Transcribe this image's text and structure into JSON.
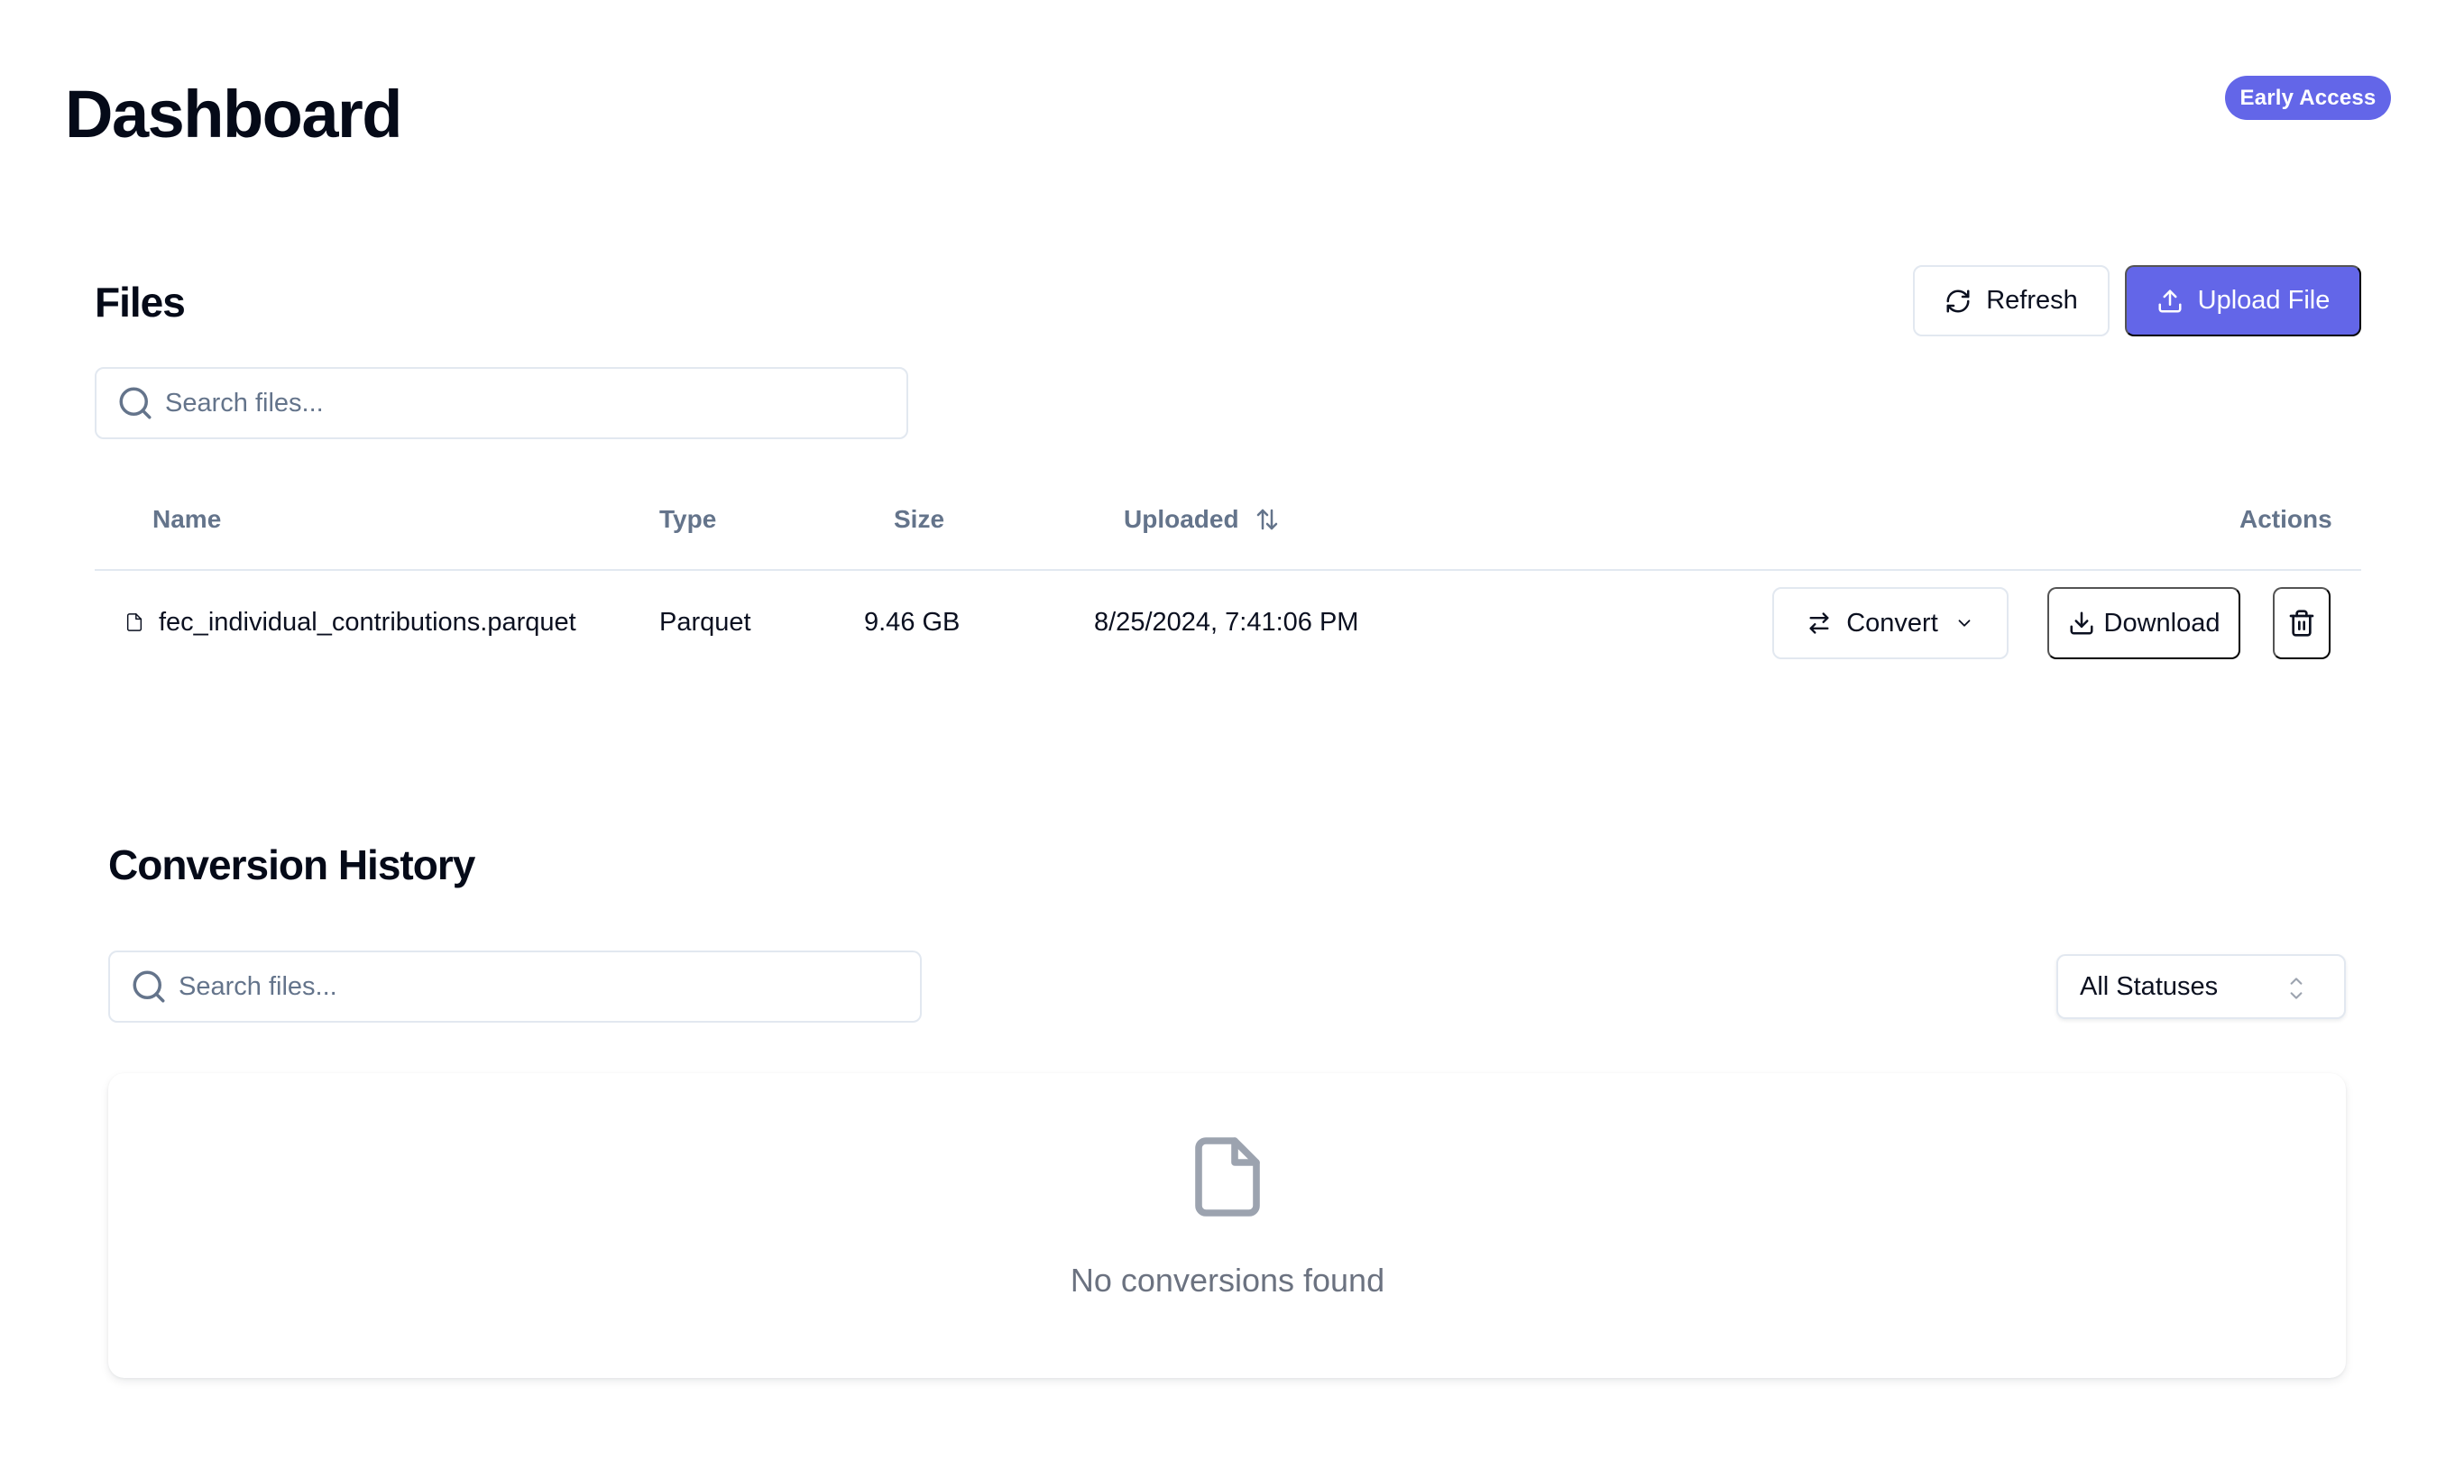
{
  "header": {
    "title": "Dashboard",
    "badge": "Early Access"
  },
  "colors": {
    "accent": "#6366e8",
    "text_primary": "#050a18",
    "text_muted": "#64748b",
    "border": "#e2e8f0",
    "empty_icon": "#9ca3af"
  },
  "files": {
    "title": "Files",
    "refresh_label": "Refresh",
    "refresh_icon": "refresh-icon",
    "upload_label": "Upload File",
    "upload_icon": "upload-icon",
    "search": {
      "placeholder": "Search files...",
      "value": ""
    },
    "table": {
      "columns": [
        {
          "label": "Name"
        },
        {
          "label": "Type"
        },
        {
          "label": "Size"
        },
        {
          "label": "Uploaded",
          "sort_icon": "sort-arrows-icon"
        },
        {
          "label": "Actions"
        }
      ],
      "rows": [
        {
          "name": "fec_individual_contributions.parquet",
          "type": "Parquet",
          "size": "9.46 GB",
          "uploaded": "8/25/2024, 7:41:06 PM",
          "actions": {
            "convert_label": "Convert",
            "download_label": "Download",
            "delete_icon": "trash-icon"
          }
        }
      ]
    }
  },
  "history": {
    "title": "Conversion History",
    "search": {
      "placeholder": "Search files...",
      "value": ""
    },
    "status_filter": {
      "selected": "All Statuses"
    },
    "empty_message": "No conversions found",
    "empty_icon": "file-icon"
  }
}
